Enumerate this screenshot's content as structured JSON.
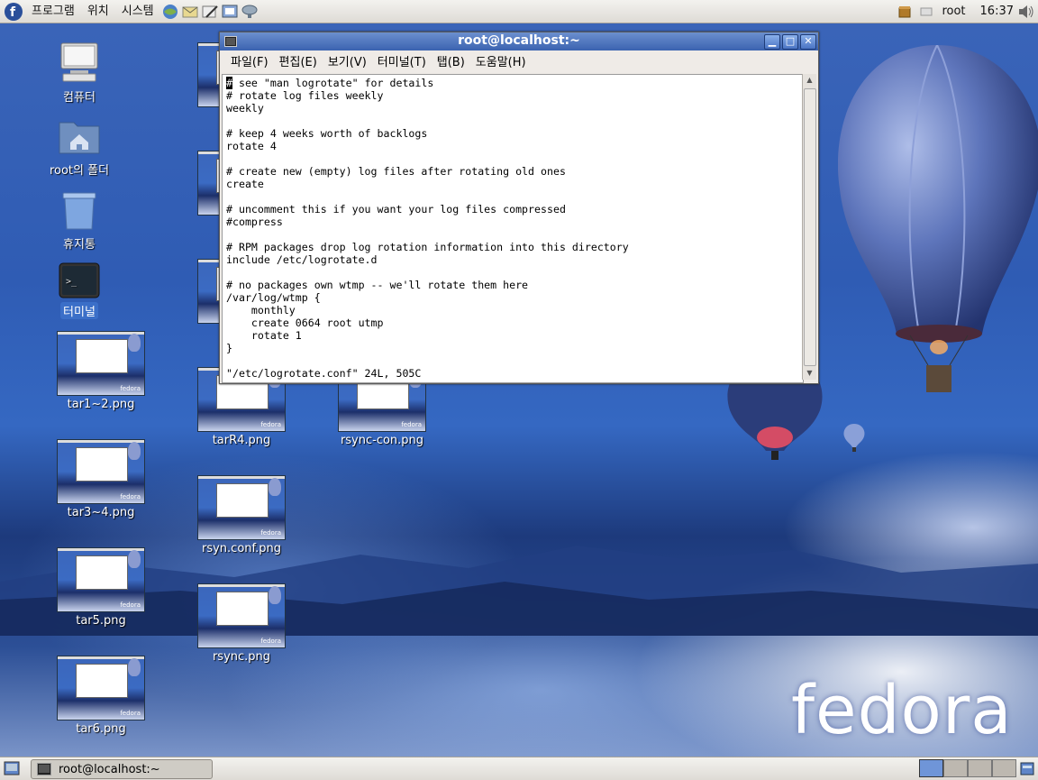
{
  "top_panel": {
    "menus": [
      "프로그램",
      "위치",
      "시스템"
    ],
    "user": "root",
    "clock": "16:37"
  },
  "desktop_icons": {
    "computer": "컴퓨터",
    "home": "root의 폴더",
    "trash": "휴지통",
    "terminal": "터미널",
    "files": [
      "tar1~2.png",
      "tar3~4.png",
      "tar5.png",
      "tar6.png",
      "tarR4.png",
      "rsync-con.png",
      "rsyn.conf.png",
      "rsync.png"
    ]
  },
  "terminal_window": {
    "title": "root@localhost:~",
    "menu": [
      "파일(F)",
      "편집(E)",
      "보기(V)",
      "터미널(T)",
      "탭(B)",
      "도움말(H)"
    ],
    "first_char": "#",
    "lines": [
      " see \"man logrotate\" for details",
      "# rotate log files weekly",
      "weekly",
      "",
      "# keep 4 weeks worth of backlogs",
      "rotate 4",
      "",
      "# create new (empty) log files after rotating old ones",
      "create",
      "",
      "# uncomment this if you want your log files compressed",
      "#compress",
      "",
      "# RPM packages drop log rotation information into this directory",
      "include /etc/logrotate.d",
      "",
      "# no packages own wtmp -- we'll rotate them here",
      "/var/log/wtmp {",
      "    monthly",
      "    create 0664 root utmp",
      "    rotate 1",
      "}",
      "",
      "\"/etc/logrotate.conf\" 24L, 505C"
    ]
  },
  "taskbar": {
    "window_button": "root@localhost:~"
  },
  "wallpaper": {
    "logo": "fedora"
  }
}
